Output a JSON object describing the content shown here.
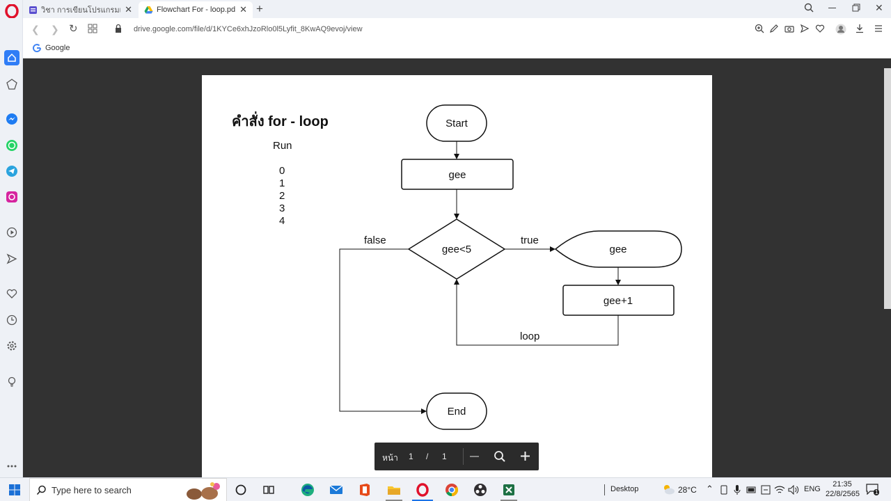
{
  "browser": {
    "tabs": [
      {
        "title": "วิชา การเขียนโปรแกรมเบื้องต้น",
        "active": false
      },
      {
        "title": "Flowchart For - loop.pdf - Go",
        "active": true
      }
    ],
    "url": "drive.google.com/file/d/1KYCe6xhJzoRlo0l5Lyfit_8KwAQ9evoj/view",
    "bookmark_label": "Google"
  },
  "document": {
    "title": "คำสั่ง for - loop",
    "run_label": "Run",
    "run_values": [
      "0",
      "1",
      "2",
      "3",
      "4"
    ],
    "flowchart": {
      "start": "Start",
      "init": "gee",
      "condition": "gee<5",
      "true_label": "true",
      "false_label": "false",
      "output": "gee",
      "increment": "gee+1",
      "loop_label": "loop",
      "end": "End"
    }
  },
  "pdf_controls": {
    "page_word": "หน้า",
    "current_page": "1",
    "separator": "/",
    "total_pages": "1"
  },
  "taskbar": {
    "search_placeholder": "Type here to search",
    "desktop_label": "Desktop",
    "temperature": "28°C",
    "language": "ENG",
    "time": "21:35",
    "date": "22/8/2565",
    "notification_count": "1"
  },
  "colors": {
    "viewer_bg": "#323232",
    "opera_red": "#e0112b",
    "accent_blue": "#1a73e8"
  }
}
